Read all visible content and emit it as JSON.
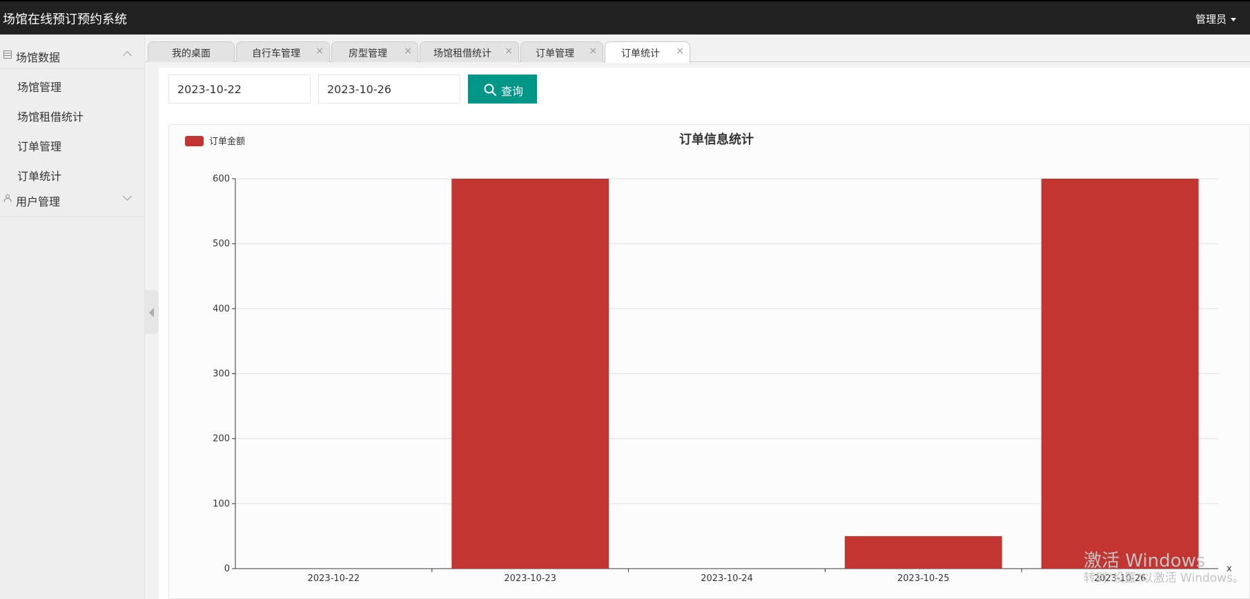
{
  "header": {
    "app_title": "场馆在线预订预约系统",
    "admin_label": "管理员"
  },
  "sidebar": {
    "groups": [
      {
        "label": "场馆数据",
        "icon": "table-icon",
        "expanded": true,
        "items": [
          {
            "label": "场馆管理"
          },
          {
            "label": "场馆租借统计"
          },
          {
            "label": "订单管理"
          },
          {
            "label": "订单统计"
          }
        ]
      },
      {
        "label": "用户管理",
        "icon": "user-icon",
        "expanded": false,
        "items": []
      }
    ]
  },
  "tabs": [
    {
      "label": "我的桌面",
      "closable": false
    },
    {
      "label": "自行车管理",
      "closable": true
    },
    {
      "label": "房型管理",
      "closable": true
    },
    {
      "label": "场馆租借统计",
      "closable": true
    },
    {
      "label": "订单管理",
      "closable": true
    },
    {
      "label": "订单统计",
      "closable": true,
      "active": true
    }
  ],
  "tab_close_glyph": "×",
  "filters": {
    "start_date": "2023-10-22",
    "end_date": "2023-10-26",
    "search_label": "查询"
  },
  "colors": {
    "header_bg": "#222222",
    "accent": "#009688",
    "bar": "#c23531"
  },
  "chart_data": {
    "type": "bar",
    "title": "订单信息统计",
    "legend": {
      "entries": [
        "订单金额"
      ],
      "placement": "top-left"
    },
    "xlabel": "x",
    "ylabel": "",
    "categories": [
      "2023-10-22",
      "2023-10-23",
      "2023-10-24",
      "2023-10-25",
      "2023-10-26"
    ],
    "series": [
      {
        "name": "订单金额",
        "values": [
          0,
          600,
          0,
          50,
          600
        ],
        "color": "#c23531"
      }
    ],
    "ylim": [
      0,
      600
    ],
    "yticks": [
      0,
      100,
      200,
      300,
      400,
      500,
      600
    ],
    "grid": true
  },
  "watermark": {
    "line1": "激活 Windows",
    "line2": "转到\"设置\"以激活 Windows。"
  }
}
